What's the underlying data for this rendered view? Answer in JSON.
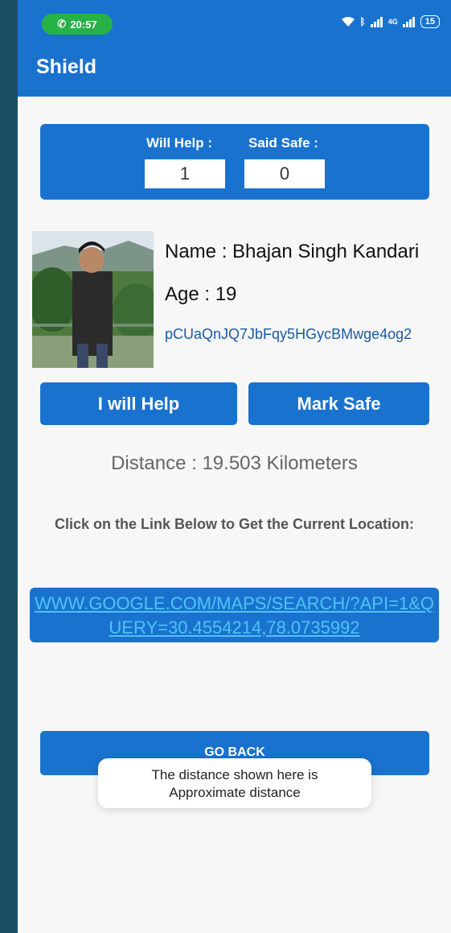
{
  "status_bar": {
    "time": "20:57",
    "network": "4G",
    "battery": "15"
  },
  "app_bar": {
    "title": "Shield"
  },
  "counters": {
    "will_help_label": "Will Help :",
    "will_help_value": "1",
    "said_safe_label": "Said Safe :",
    "said_safe_value": "0"
  },
  "person": {
    "name": "Name : Bhajan Singh Kandari",
    "age": "Age : 19",
    "id": "pCUaQnJQ7JbFqy5HGycBMwge4og2"
  },
  "actions": {
    "help_label": "I will Help",
    "safe_label": "Mark Safe",
    "back_label": "GO BACK"
  },
  "distance": "Distance : 19.503 Kilometers",
  "instruction": "Click on the Link Below to Get the Current Location:",
  "map_link": "WWW.GOOGLE.COM/MAPS/SEARCH/?API=1&QUERY=30.4554214,78.0735992",
  "toast": {
    "line1": "The distance shown here is",
    "line2": "Approximate distance"
  },
  "colors": {
    "primary": "#1a72cf",
    "link": "#4fc3f7",
    "call_pill": "#27b247"
  },
  "icons": [
    "phone-icon",
    "wifi-icon",
    "bluetooth-icon",
    "signal-icon",
    "battery-icon"
  ]
}
